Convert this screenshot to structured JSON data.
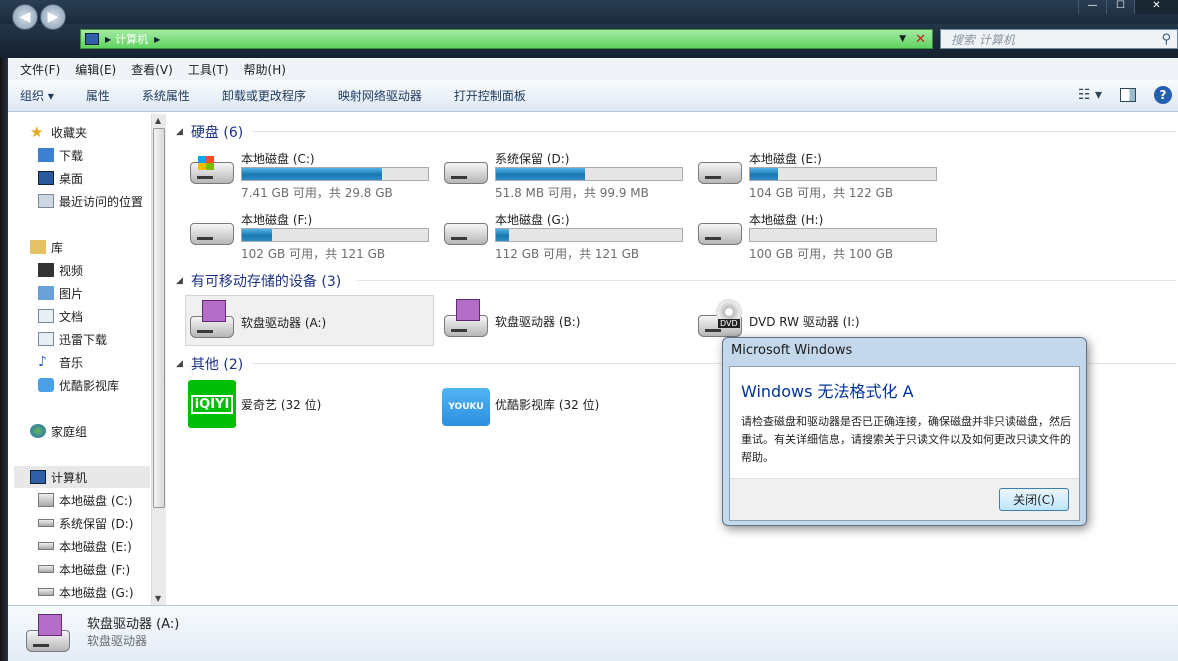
{
  "window": {
    "controls": [
      "—",
      "☐",
      "✕"
    ]
  },
  "address": {
    "crumb": "计算机",
    "dropdown_icon": "chevron-down-icon"
  },
  "search": {
    "placeholder": "搜索 计算机"
  },
  "menu": [
    "文件(F)",
    "编辑(E)",
    "查看(V)",
    "工具(T)",
    "帮助(H)"
  ],
  "toolbar": {
    "organize": "组织 ▾",
    "items": [
      "属性",
      "系统属性",
      "卸载或更改程序",
      "映射网络驱动器",
      "打开控制面板"
    ]
  },
  "nav": {
    "favorites": {
      "label": "收藏夹",
      "items": [
        "下载",
        "桌面",
        "最近访问的位置"
      ]
    },
    "libraries": {
      "label": "库",
      "items": [
        "视频",
        "图片",
        "文档",
        "迅雷下载",
        "音乐",
        "优酷影视库"
      ]
    },
    "homegroup": {
      "label": "家庭组"
    },
    "computer": {
      "label": "计算机",
      "items": [
        "本地磁盘 (C:)",
        "系统保留 (D:)",
        "本地磁盘 (E:)",
        "本地磁盘 (F:)",
        "本地磁盘 (G:)"
      ]
    }
  },
  "sections": {
    "hdd": "硬盘 (6)",
    "removable": "有可移动存储的设备 (3)",
    "other": "其他 (2)"
  },
  "drives": [
    {
      "name": "本地磁盘 (C:)",
      "size": "7.41 GB 可用，共 29.8 GB",
      "used": 0.75
    },
    {
      "name": "系统保留 (D:)",
      "size": "51.8 MB 可用，共 99.9 MB",
      "used": 0.48
    },
    {
      "name": "本地磁盘 (E:)",
      "size": "104 GB 可用，共 122 GB",
      "used": 0.15
    },
    {
      "name": "本地磁盘 (F:)",
      "size": "102 GB 可用，共 121 GB",
      "used": 0.16
    },
    {
      "name": "本地磁盘 (G:)",
      "size": "112 GB 可用，共 121 GB",
      "used": 0.07
    },
    {
      "name": "本地磁盘 (H:)",
      "size": "100 GB 可用，共 100 GB",
      "used": 0.0
    }
  ],
  "removable": [
    "软盘驱动器 (A:)",
    "软盘驱动器 (B:)",
    "DVD RW 驱动器 (I:)"
  ],
  "other": [
    "爱奇艺 (32 位)",
    "优酷影视库 (32 位)"
  ],
  "brand": {
    "iqiyi": "iQIYI",
    "youku": "YOUKU",
    "dvd": "DVD"
  },
  "details": {
    "name": "软盘驱动器 (A:)",
    "type": "软盘驱动器"
  },
  "dialog": {
    "title": "Microsoft Windows",
    "heading": "Windows 无法格式化 A",
    "message": "请检查磁盘和驱动器是否已正确连接，确保磁盘并非只读磁盘，然后重试。有关详细信息，请搜索关于只读文件以及如何更改只读文件的帮助。",
    "close": "关闭(C)"
  },
  "colors": {
    "address_bar": "#5fd35f",
    "bar_fill": "#1a78b0",
    "dialog_heading": "#003399",
    "iqiyi": "#00be06",
    "youku": "#2b8fe0"
  }
}
